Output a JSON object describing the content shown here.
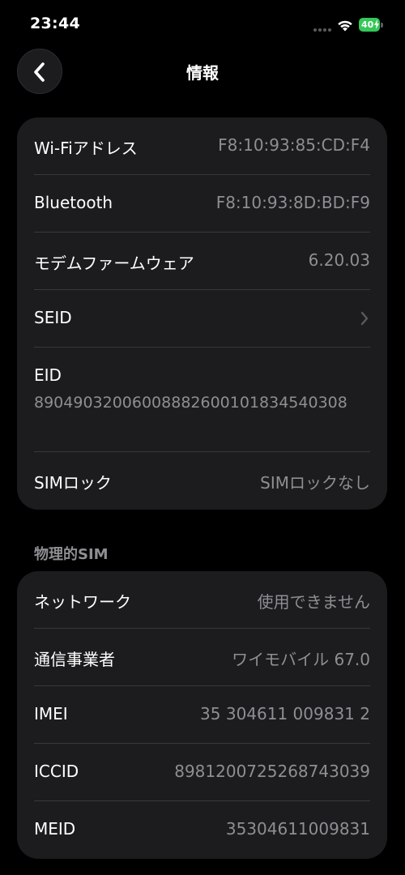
{
  "status_bar": {
    "time": "23:44",
    "battery_level": "40",
    "icons": [
      "cellular-dots-icon",
      "wifi-icon",
      "battery-charging-icon"
    ],
    "battery_color": "#35c759"
  },
  "nav": {
    "title": "情報",
    "back_icon": "chevron-left-icon"
  },
  "info_card": {
    "rows": [
      {
        "label": "Wi-Fiアドレス",
        "value": "F8:10:93:85:CD:F4"
      },
      {
        "label": "Bluetooth",
        "value": "F8:10:93:8D:BD:F9"
      },
      {
        "label": "モデムファームウェア",
        "value": "6.20.03"
      },
      {
        "label": "SEID",
        "value": ""
      },
      {
        "label": "EID",
        "value": "89049032006008882600101834540308"
      },
      {
        "label": "SIMロック",
        "value": "SIMロックなし"
      }
    ]
  },
  "physical_sim": {
    "header": "物理的SIM",
    "rows": [
      {
        "label": "ネットワーク",
        "value": "使用できません"
      },
      {
        "label": "通信事業者",
        "value": "ワイモバイル 67.0"
      },
      {
        "label": "IMEI",
        "value": "35 304611 009831 2"
      },
      {
        "label": "ICCID",
        "value": "8981200725268743039"
      },
      {
        "label": "MEID",
        "value": "35304611009831"
      }
    ]
  },
  "colors": {
    "background": "#000000",
    "card": "#1c1c1e",
    "secondary_text": "#8e8e93",
    "separator": "#38383a"
  }
}
